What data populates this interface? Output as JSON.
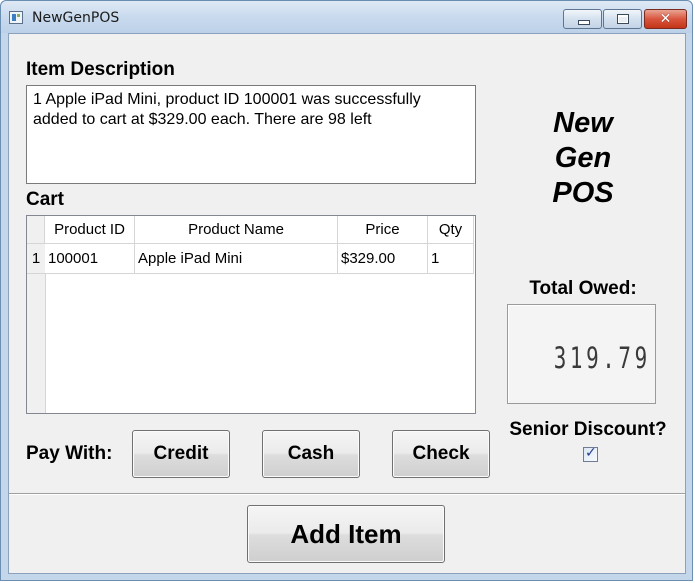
{
  "window": {
    "title": "NewGenPOS"
  },
  "item_description": {
    "label": "Item Description",
    "text": "1 Apple iPad Mini, product ID 100001 was successfully added to cart at $329.00 each. There are 98 left"
  },
  "brand": {
    "line1": "New",
    "line2": "Gen",
    "line3": "POS"
  },
  "cart": {
    "label": "Cart",
    "columns": [
      "Product ID",
      "Product Name",
      "Price",
      "Qty"
    ],
    "rows": [
      {
        "num": "1",
        "product_id": "100001",
        "product_name": "Apple iPad Mini",
        "price": "$329.00",
        "qty": "1"
      }
    ]
  },
  "total": {
    "label": "Total Owed:",
    "value": "319.79"
  },
  "senior_discount": {
    "label": "Senior Discount?",
    "checked": true
  },
  "pay": {
    "label": "Pay With:",
    "credit": "Credit",
    "cash": "Cash",
    "check": "Check"
  },
  "add_item": "Add Item",
  "colors": {
    "titlebar": "#c9daee",
    "close_button": "#d9553e",
    "client_bg": "#f0f0f0"
  }
}
